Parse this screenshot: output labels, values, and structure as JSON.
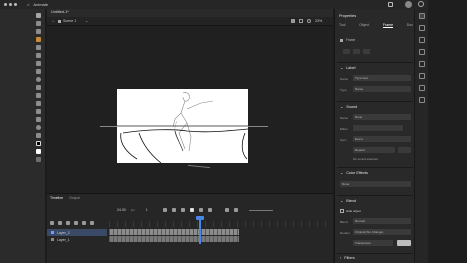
{
  "app": {
    "name": "Animate",
    "document_tab": "Untitled-1*"
  },
  "scene": {
    "label": "Scene 1",
    "zoom": "23%"
  },
  "timeline": {
    "tabs": [
      "Timeline",
      "Output"
    ],
    "fps": "24.00",
    "current_frame": "1",
    "layers": [
      {
        "name": "Layer_2"
      },
      {
        "name": "Layer_1"
      }
    ]
  },
  "properties": {
    "header": "Properties",
    "tabs": [
      "Tool",
      "Object",
      "Frame",
      "Doc"
    ],
    "frame_label": "Frame",
    "label_section": "Label",
    "label_name_caption": "Name",
    "label_name_value": "Type here",
    "label_type_caption": "Type",
    "label_type_value": "Name",
    "sound_section": "Sound",
    "sound_name_caption": "Name",
    "sound_name_value": "None",
    "sound_effect_caption": "Effect",
    "sound_sync_caption": "Sync",
    "sound_sync_value": "Event",
    "sound_repeat_value": "Repeat",
    "no_sound": "No sound selected",
    "color_effects_section": "Color Effects",
    "color_effects_value": "None",
    "blend_section": "Blend",
    "hide_object": "Hide object",
    "blend_caption": "Blend",
    "blend_value": "Normal",
    "render_caption": "Render",
    "render_value": "Original (No Change)",
    "background_value": "Transparent",
    "filters_section": "Filters"
  },
  "colors": {
    "accent": "#4a86e8",
    "stage": "#ffffff",
    "panel": "#292929"
  }
}
